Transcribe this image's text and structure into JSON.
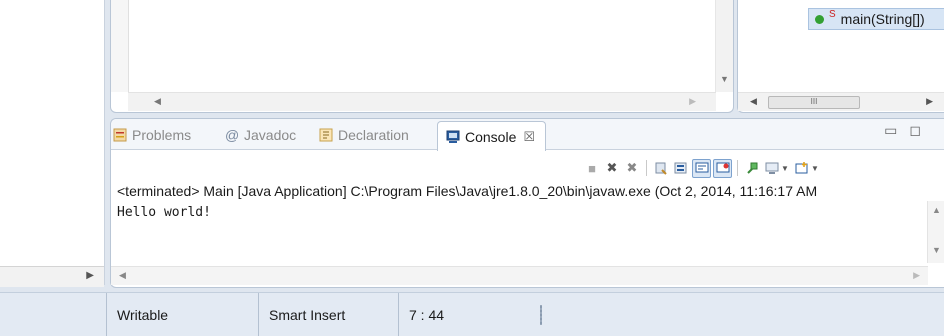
{
  "outline": {
    "method_modifier": "S",
    "method_label": "main(String[])",
    "scroll_thumb": "III"
  },
  "console_view": {
    "tabs": [
      {
        "label": "Problems",
        "icon": "problems-icon"
      },
      {
        "label": "Javadoc",
        "icon": "at-icon"
      },
      {
        "label": "Declaration",
        "icon": "declaration-icon"
      },
      {
        "label": "Console",
        "icon": "console-icon",
        "active": true
      }
    ],
    "close_glyph": "☒",
    "terminated_line": "<terminated> Main [Java Application] C:\\Program Files\\Java\\jre1.8.0_20\\bin\\javaw.exe (Oct 2, 2014, 11:16:17 AM",
    "output": "Hello world!",
    "toolbar_icons": [
      "terminate-icon",
      "remove-launch-icon",
      "remove-all-terminated-icon",
      "clear-console-icon",
      "scroll-lock-icon",
      "word-wrap-icon",
      "show-on-stdout-icon",
      "show-on-stderr-icon",
      "pin-console-icon",
      "display-console-icon",
      "open-console-icon"
    ]
  },
  "status_bar": {
    "writable": "Writable",
    "insert_mode": "Smart Insert",
    "position": "7 : 44"
  },
  "colors": {
    "accent": "#2a5d9f",
    "active_tab_bg": "#ffffff",
    "status_bg": "#e3eaf3"
  }
}
